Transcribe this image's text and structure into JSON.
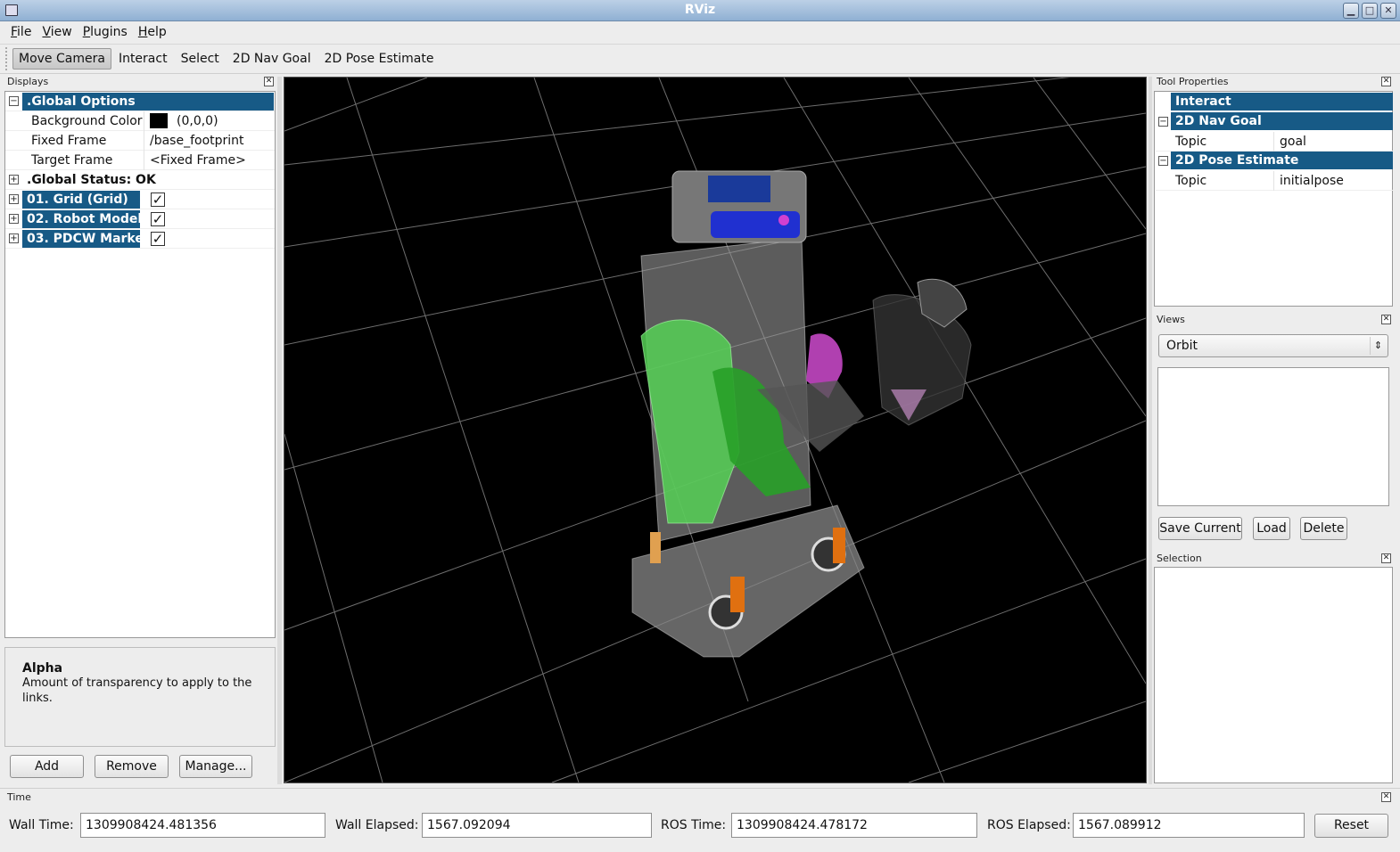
{
  "window": {
    "title": "RViz"
  },
  "menu": {
    "file": "File",
    "view": "View",
    "plugins": "Plugins",
    "help": "Help"
  },
  "toolbar": {
    "move_camera": "Move Camera",
    "interact": "Interact",
    "select": "Select",
    "nav_goal": "2D Nav Goal",
    "pose_estimate": "2D Pose Estimate"
  },
  "displays": {
    "panel_title": "Displays",
    "global_options": {
      "label": ".Global Options",
      "background_color": {
        "name": "Background Color",
        "value": "(0,0,0)"
      },
      "fixed_frame": {
        "name": "Fixed Frame",
        "value": "/base_footprint"
      },
      "target_frame": {
        "name": "Target Frame",
        "value": "<Fixed Frame>"
      }
    },
    "global_status": ".Global Status: OK",
    "items": [
      {
        "label": "01. Grid (Grid)",
        "enabled": true
      },
      {
        "label": "02. Robot Model",
        "enabled": true
      },
      {
        "label": "03. PDCW Marke",
        "enabled": true
      }
    ],
    "help": {
      "title": "Alpha",
      "text": "Amount of transparency to apply to the links."
    },
    "buttons": {
      "add": "Add",
      "remove": "Remove",
      "manage": "Manage..."
    }
  },
  "tool_properties": {
    "panel_title": "Tool Properties",
    "interact": "Interact",
    "nav_goal": {
      "label": "2D Nav Goal",
      "topic_name": "Topic",
      "topic_value": "goal"
    },
    "pose_estimate": {
      "label": "2D Pose Estimate",
      "topic_name": "Topic",
      "topic_value": "initialpose"
    }
  },
  "views": {
    "panel_title": "Views",
    "selected": "Orbit",
    "buttons": {
      "save": "Save Current",
      "load": "Load",
      "delete": "Delete"
    }
  },
  "selection": {
    "panel_title": "Selection"
  },
  "time": {
    "panel_title": "Time",
    "wall_time_label": "Wall Time:",
    "wall_time": "1309908424.481356",
    "wall_elapsed_label": "Wall Elapsed:",
    "wall_elapsed": "1567.092094",
    "ros_time_label": "ROS Time:",
    "ros_time": "1309908424.478172",
    "ros_elapsed_label": "ROS Elapsed:",
    "ros_elapsed": "1567.089912",
    "reset": "Reset"
  },
  "icons": {
    "close": "close-icon",
    "expand": "plus-icon",
    "collapse": "minus-icon",
    "check": "checkmark-icon",
    "combo": "updown-arrow-icon"
  }
}
